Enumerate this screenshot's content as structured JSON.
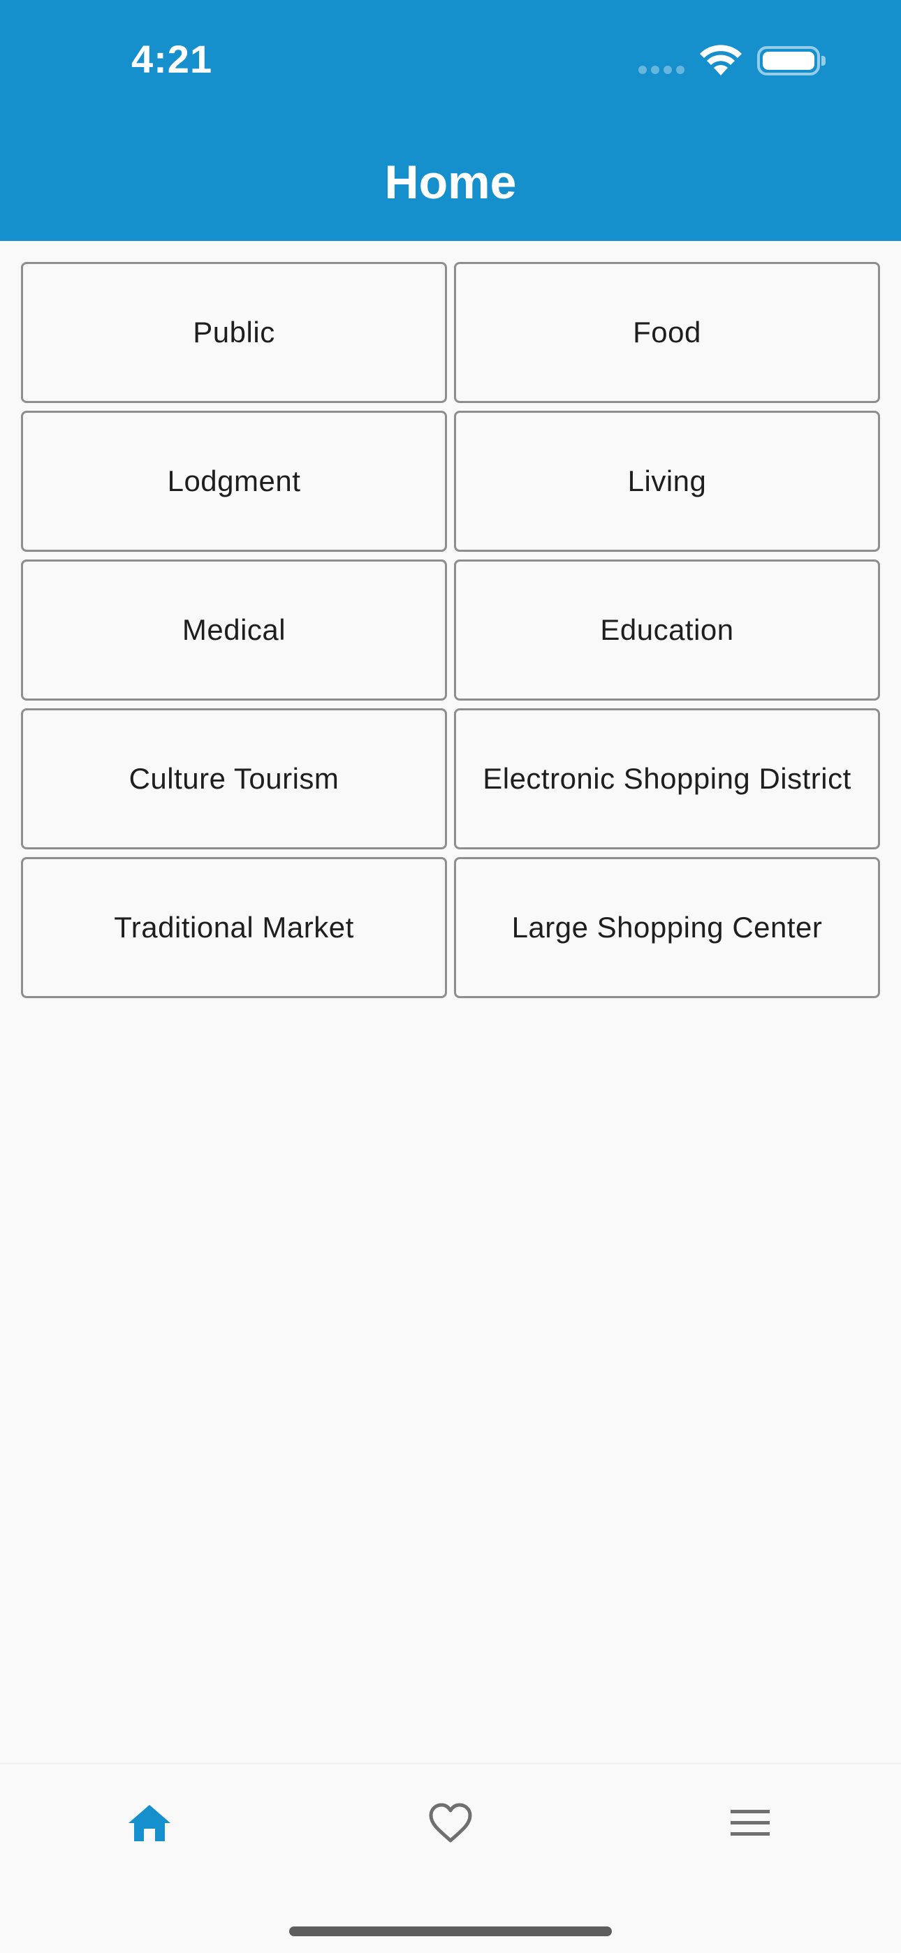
{
  "status_bar": {
    "time": "4:21"
  },
  "header": {
    "title": "Home",
    "background_color": "#1590cc"
  },
  "categories": [
    {
      "label": "Public"
    },
    {
      "label": "Food"
    },
    {
      "label": "Lodgment"
    },
    {
      "label": "Living"
    },
    {
      "label": "Medical"
    },
    {
      "label": "Education"
    },
    {
      "label": "Culture Tourism"
    },
    {
      "label": "Electronic Shopping District"
    },
    {
      "label": "Traditional Market"
    },
    {
      "label": "Large Shopping Center"
    }
  ],
  "bottom_nav": {
    "items": [
      {
        "icon": "home-icon",
        "active": true
      },
      {
        "icon": "heart-icon",
        "active": false
      },
      {
        "icon": "menu-icon",
        "active": false
      }
    ],
    "active_color": "#1590cc",
    "inactive_color": "#6f6f6f"
  }
}
